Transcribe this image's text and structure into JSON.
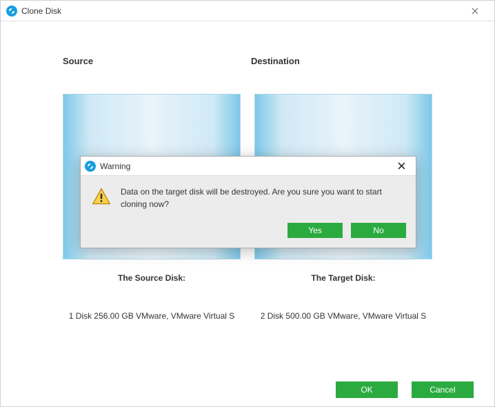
{
  "window": {
    "title": "Clone Disk"
  },
  "headers": {
    "source": "Source",
    "destination": "Destination"
  },
  "labels": {
    "source_disk": "The Source Disk:",
    "target_disk": "The Target Disk:"
  },
  "disks": {
    "source_desc": "1 Disk 256.00 GB VMware,  VMware Virtual S",
    "target_desc": "2 Disk 500.00 GB VMware,  VMware Virtual S"
  },
  "footer": {
    "ok": "OK",
    "cancel": "Cancel"
  },
  "modal": {
    "title": "Warning",
    "message": "Data on the target disk will be destroyed. Are you sure you want to start cloning now?",
    "yes": "Yes",
    "no": "No"
  }
}
